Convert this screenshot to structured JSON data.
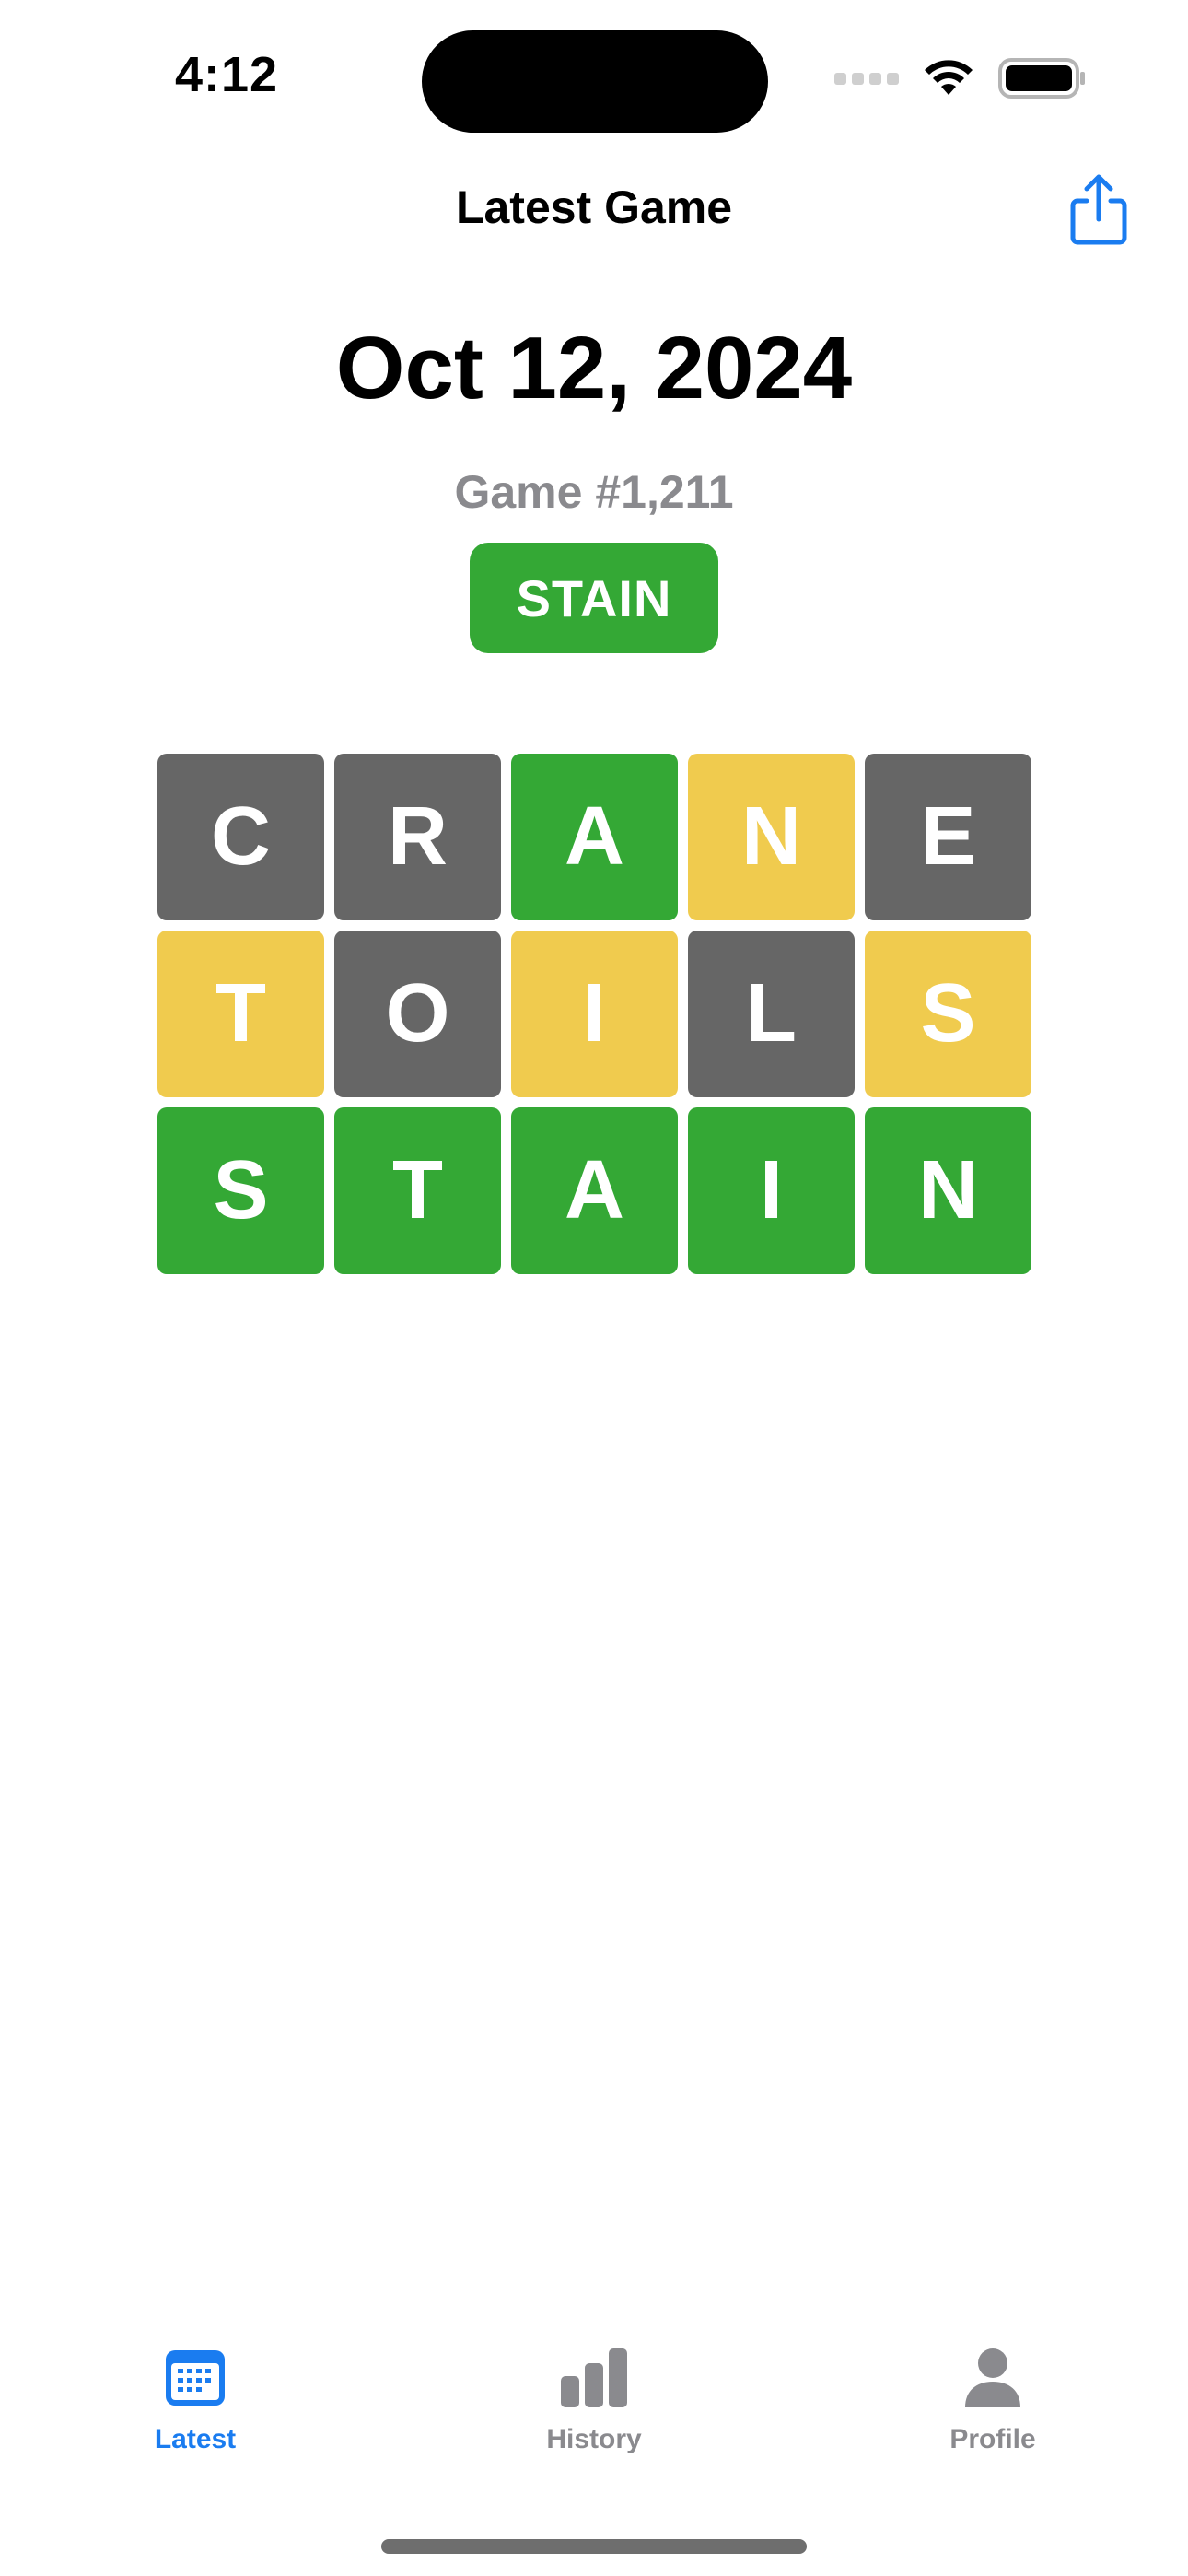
{
  "status_bar": {
    "time": "4:12"
  },
  "header": {
    "title": "Latest Game",
    "share_icon": "share-icon"
  },
  "game": {
    "date": "Oct 12, 2024",
    "number": "Game #1,211",
    "answer": "STAIN",
    "answer_color": "#34a835"
  },
  "colors": {
    "green": "#34a835",
    "yellow": "#f0cb4e",
    "gray": "#666666",
    "accent": "#1a7cf0",
    "inactive": "#8a8a8e"
  },
  "guesses": [
    {
      "tiles": [
        {
          "letter": "C",
          "state": "gray"
        },
        {
          "letter": "R",
          "state": "gray"
        },
        {
          "letter": "A",
          "state": "green"
        },
        {
          "letter": "N",
          "state": "yellow"
        },
        {
          "letter": "E",
          "state": "gray"
        }
      ]
    },
    {
      "tiles": [
        {
          "letter": "T",
          "state": "yellow"
        },
        {
          "letter": "O",
          "state": "gray"
        },
        {
          "letter": "I",
          "state": "yellow"
        },
        {
          "letter": "L",
          "state": "gray"
        },
        {
          "letter": "S",
          "state": "yellow"
        }
      ]
    },
    {
      "tiles": [
        {
          "letter": "S",
          "state": "green"
        },
        {
          "letter": "T",
          "state": "green"
        },
        {
          "letter": "A",
          "state": "green"
        },
        {
          "letter": "I",
          "state": "green"
        },
        {
          "letter": "N",
          "state": "green"
        }
      ]
    }
  ],
  "tab_bar": {
    "tabs": [
      {
        "label": "Latest",
        "icon": "calendar-icon",
        "selected": true
      },
      {
        "label": "History",
        "icon": "bar-chart-icon",
        "selected": false
      },
      {
        "label": "Profile",
        "icon": "person-icon",
        "selected": false
      }
    ]
  }
}
